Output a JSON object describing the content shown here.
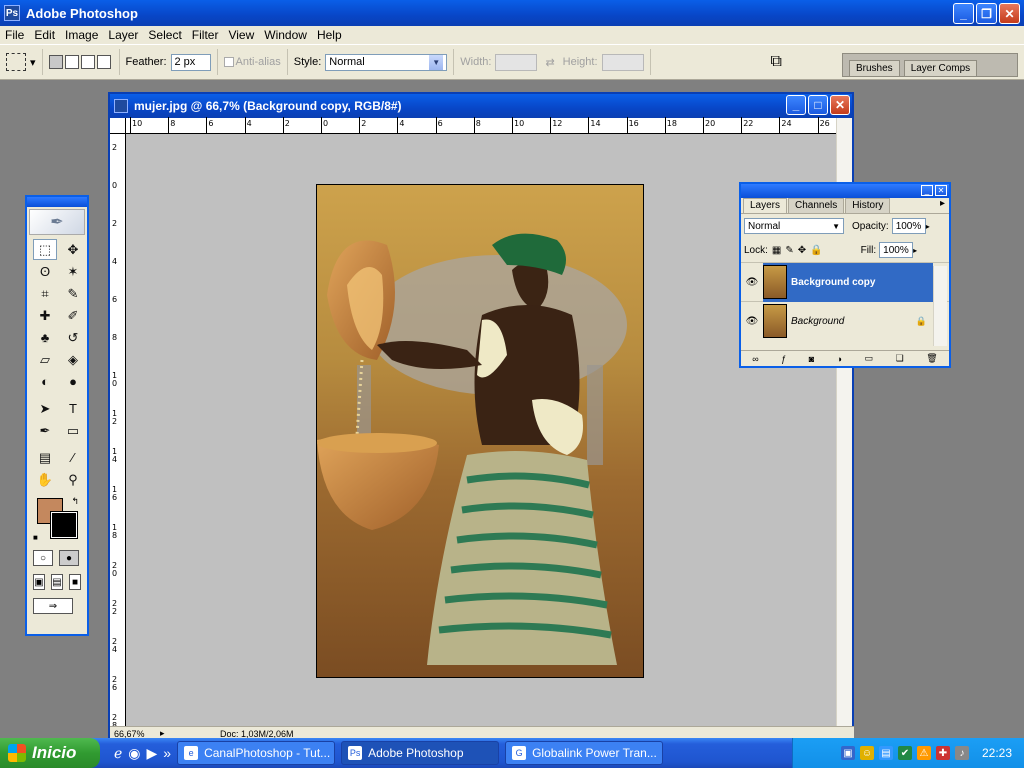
{
  "app": {
    "title": "Adobe Photoshop",
    "logo": "Ps"
  },
  "menu": [
    "File",
    "Edit",
    "Image",
    "Layer",
    "Select",
    "Filter",
    "View",
    "Window",
    "Help"
  ],
  "options": {
    "feather_label": "Feather:",
    "feather_value": "2 px",
    "antialias_label": "Anti-alias",
    "style_label": "Style:",
    "style_value": "Normal",
    "width_label": "Width:",
    "height_label": "Height:",
    "palette_tabs": [
      "Brushes",
      "Layer Comps"
    ]
  },
  "document": {
    "title": "mujer.jpg @ 66,7% (Background copy, RGB/8#)",
    "zoom": "66,67%",
    "doc_info": "Doc: 1,03M/2,06M",
    "ruler_h": [
      "10",
      "8",
      "6",
      "4",
      "2",
      "0",
      "2",
      "4",
      "6",
      "8",
      "10",
      "12",
      "14",
      "16",
      "18",
      "20",
      "22",
      "24",
      "26"
    ],
    "ruler_v": [
      "2",
      "0",
      "2",
      "4",
      "6",
      "8",
      "10",
      "12",
      "14",
      "16",
      "18",
      "20",
      "22",
      "24",
      "26",
      "28"
    ]
  },
  "tools": {
    "items": [
      {
        "name": "marquee-tool",
        "glyph": "⬚"
      },
      {
        "name": "move-tool",
        "glyph": "✥"
      },
      {
        "name": "lasso-tool",
        "glyph": "ʘ"
      },
      {
        "name": "magic-wand-tool",
        "glyph": "✶"
      },
      {
        "name": "crop-tool",
        "glyph": "⌗"
      },
      {
        "name": "slice-tool",
        "glyph": "✎"
      },
      {
        "name": "healing-brush-tool",
        "glyph": "✚"
      },
      {
        "name": "brush-tool",
        "glyph": "✐"
      },
      {
        "name": "clone-stamp-tool",
        "glyph": "♣"
      },
      {
        "name": "history-brush-tool",
        "glyph": "↺"
      },
      {
        "name": "eraser-tool",
        "glyph": "▱"
      },
      {
        "name": "paint-bucket-tool",
        "glyph": "◈"
      },
      {
        "name": "blur-tool",
        "glyph": "◐"
      },
      {
        "name": "dodge-tool",
        "glyph": "●"
      },
      {
        "name": "path-select-tool",
        "glyph": "➤"
      },
      {
        "name": "type-tool",
        "glyph": "T"
      },
      {
        "name": "pen-tool",
        "glyph": "✒"
      },
      {
        "name": "shape-tool",
        "glyph": "▭"
      },
      {
        "name": "notes-tool",
        "glyph": "▤"
      },
      {
        "name": "eyedropper-tool",
        "glyph": "⁄"
      },
      {
        "name": "hand-tool",
        "glyph": "✋"
      },
      {
        "name": "zoom-tool",
        "glyph": "⚲"
      }
    ],
    "foreground": "#c4885e",
    "background": "#000000"
  },
  "layers_panel": {
    "tabs": [
      "Layers",
      "Channels",
      "History"
    ],
    "blend_mode": "Normal",
    "opacity_label": "Opacity:",
    "opacity": "100%",
    "lock_label": "Lock:",
    "fill_label": "Fill:",
    "fill": "100%",
    "layers": [
      {
        "name": "Background copy",
        "selected": true
      },
      {
        "name": "Background",
        "selected": false,
        "locked": true
      }
    ]
  },
  "taskbar": {
    "start": "Inicio",
    "tasks": [
      {
        "label": "CanalPhotoshop - Tut...",
        "active": false
      },
      {
        "label": "Adobe Photoshop",
        "active": true
      },
      {
        "label": "Globalink Power Tran...",
        "active": false
      }
    ],
    "clock": "22:23"
  }
}
